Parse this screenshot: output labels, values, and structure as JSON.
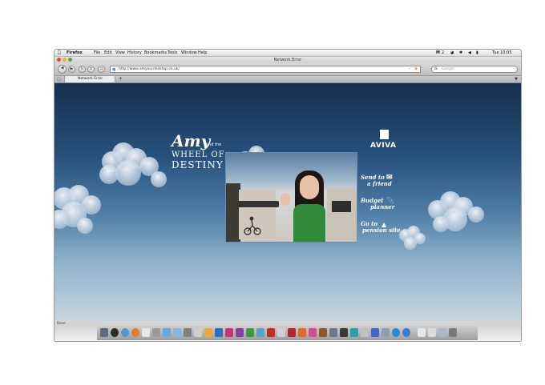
{
  "menubar": {
    "items": [
      "Firefox",
      "File",
      "Edit",
      "View",
      "History",
      "Bookmarks",
      "Tools",
      "Window",
      "Help"
    ],
    "clock": "Tue 10:05",
    "badge": "2"
  },
  "window": {
    "title": "Network Error"
  },
  "toolbar": {
    "url": "http://www.amyourdesktop.co.uk/",
    "search_placeholder": "Google"
  },
  "tabs": [
    {
      "label": "Network Error"
    }
  ],
  "new_tab_label": "+",
  "status": {
    "text": "Done"
  },
  "page": {
    "amy": "Amy",
    "and_the": "and the",
    "wheel_of": "WHEEL OF",
    "destiny": "DESTINY",
    "brand": "AVIVA",
    "links": [
      {
        "line1": "Send to",
        "line2": "a friend"
      },
      {
        "line1": "Budget",
        "line2": "planner"
      },
      {
        "line1": "Go to",
        "line2": "pension site"
      }
    ]
  },
  "colors": {
    "sky_top": "#16304f",
    "sky_bottom": "#c7d6e0",
    "window_chrome": "#d8d8d8",
    "link_text": "#ffffff"
  },
  "icons": [
    "apple-icon",
    "back-icon",
    "forward-icon",
    "reload-icon",
    "home-icon",
    "rss-icon",
    "bookmark-star-icon",
    "google-icon",
    "envelope-icon",
    "paperclip-icon",
    "mortarboard-icon",
    "wifi-icon",
    "volume-icon",
    "bluetooth-icon"
  ]
}
